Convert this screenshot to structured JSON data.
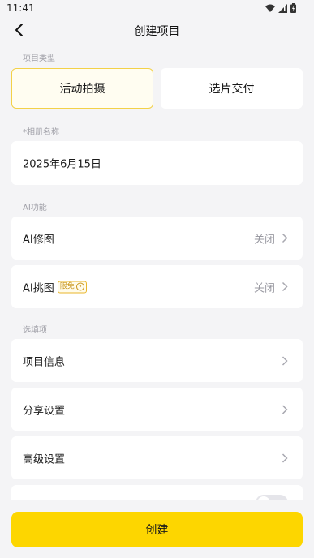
{
  "status": {
    "time": "11:41"
  },
  "nav": {
    "title": "创建项目"
  },
  "project_type": {
    "label": "项目类型",
    "options": [
      {
        "label": "活动拍摄",
        "selected": true
      },
      {
        "label": "选片交付",
        "selected": false
      }
    ]
  },
  "album": {
    "label": "*相册名称",
    "value": "2025年6月15日"
  },
  "ai": {
    "label": "AI功能",
    "retouch": {
      "label": "AI修图",
      "value": "关闭"
    },
    "select": {
      "label": "AI挑图",
      "badge": "限免",
      "value": "关闭"
    }
  },
  "optional": {
    "label": "选填项",
    "items": [
      {
        "label": "项目信息"
      },
      {
        "label": "分享设置"
      },
      {
        "label": "高级设置"
      }
    ]
  },
  "footer": {
    "create_label": "创建"
  },
  "colors": {
    "accent": "#fdd600",
    "selected_border": "#f3d148",
    "badge": "#e8b52b"
  }
}
